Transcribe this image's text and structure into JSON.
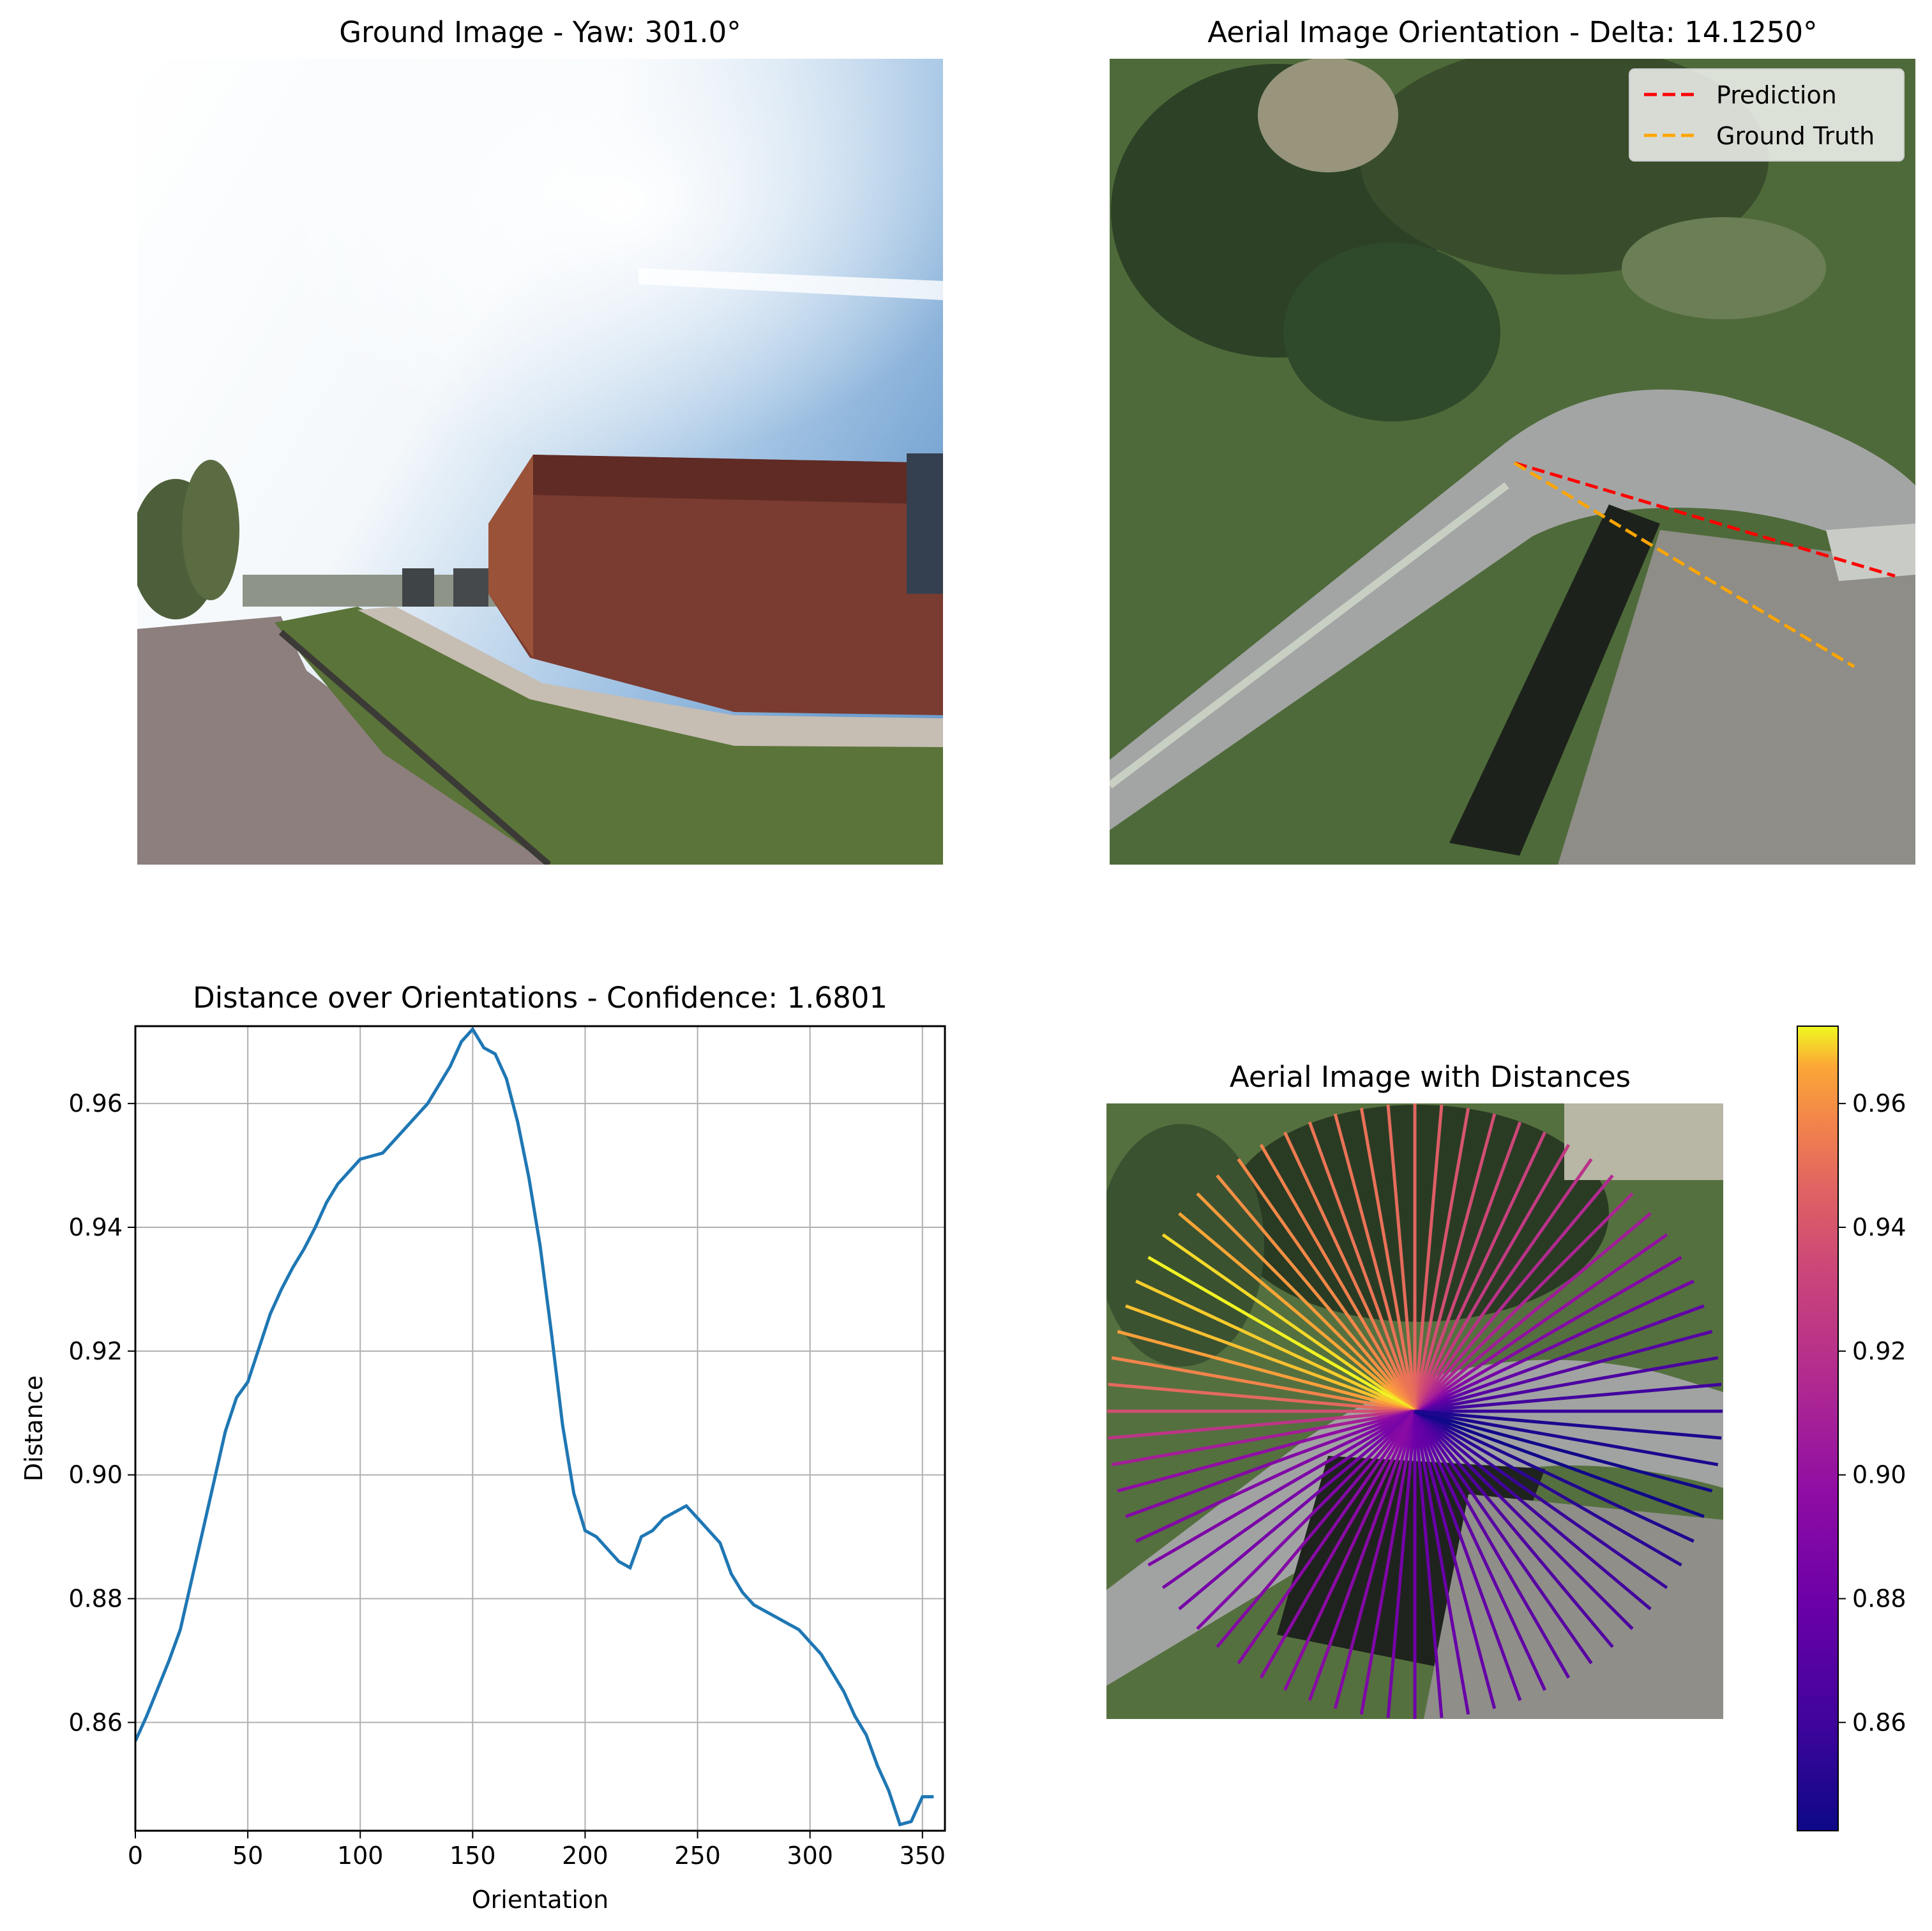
{
  "figure": {
    "ground": {
      "title": "Ground Image - Yaw: 301.0°"
    },
    "aerial": {
      "title": "Aerial Image Orientation - Delta: 14.1250°",
      "legend": [
        {
          "label": "Prediction",
          "color": "#ff0000",
          "style": "dashed"
        },
        {
          "label": "Ground Truth",
          "color": "#ffa500",
          "style": "dashed"
        }
      ]
    },
    "distances": {
      "title": "Aerial Image with Distances",
      "colormap": "plasma"
    }
  },
  "chart_data": [
    {
      "type": "line",
      "title": "Distance over Orientations - Confidence: 1.6801",
      "xlabel": "Orientation",
      "ylabel": "Distance",
      "xlim": [
        0,
        360
      ],
      "ylim": [
        0.8425,
        0.9725
      ],
      "xticks": [
        "0",
        "50",
        "100",
        "150",
        "200",
        "250",
        "300",
        "350"
      ],
      "yticks": [
        "0.86",
        "0.88",
        "0.90",
        "0.92",
        "0.94",
        "0.96"
      ],
      "grid": true,
      "color": "#1f77b4",
      "x": [
        0,
        5,
        10,
        15,
        20,
        25,
        30,
        35,
        40,
        45,
        50,
        55,
        60,
        65,
        70,
        75,
        80,
        85,
        90,
        95,
        100,
        105,
        110,
        115,
        120,
        125,
        130,
        135,
        140,
        145,
        150,
        155,
        160,
        165,
        170,
        175,
        180,
        185,
        190,
        195,
        200,
        205,
        210,
        215,
        220,
        225,
        230,
        235,
        240,
        245,
        250,
        255,
        260,
        265,
        270,
        275,
        280,
        285,
        290,
        295,
        300,
        305,
        310,
        315,
        320,
        325,
        330,
        335,
        340,
        345,
        350,
        355
      ],
      "y": [
        0.857,
        0.861,
        0.8655,
        0.87,
        0.875,
        0.883,
        0.891,
        0.899,
        0.907,
        0.9125,
        0.915,
        0.9205,
        0.926,
        0.93,
        0.9335,
        0.9365,
        0.94,
        0.944,
        0.947,
        0.949,
        0.951,
        0.9515,
        0.952,
        0.954,
        0.956,
        0.958,
        0.96,
        0.963,
        0.966,
        0.97,
        0.972,
        0.969,
        0.968,
        0.964,
        0.957,
        0.948,
        0.937,
        0.923,
        0.908,
        0.897,
        0.891,
        0.89,
        0.888,
        0.886,
        0.885,
        0.89,
        0.891,
        0.893,
        0.894,
        0.895,
        0.893,
        0.891,
        0.889,
        0.884,
        0.881,
        0.879,
        0.878,
        0.877,
        0.876,
        0.875,
        0.873,
        0.871,
        0.868,
        0.865,
        0.861,
        0.858,
        0.853,
        0.849,
        0.8435,
        0.844,
        0.848,
        0.848
      ]
    },
    {
      "type": "radial",
      "title": "Aerial Image with Distances",
      "colorbar_ticks": [
        "0.86",
        "0.88",
        "0.90",
        "0.92",
        "0.94",
        "0.96"
      ],
      "colorbar_range": [
        0.8425,
        0.9725
      ],
      "orientations": [
        0,
        5,
        10,
        15,
        20,
        25,
        30,
        35,
        40,
        45,
        50,
        55,
        60,
        65,
        70,
        75,
        80,
        85,
        90,
        95,
        100,
        105,
        110,
        115,
        120,
        125,
        130,
        135,
        140,
        145,
        150,
        155,
        160,
        165,
        170,
        175,
        180,
        185,
        190,
        195,
        200,
        205,
        210,
        215,
        220,
        225,
        230,
        235,
        240,
        245,
        250,
        255,
        260,
        265,
        270,
        275,
        280,
        285,
        290,
        295,
        300,
        305,
        310,
        315,
        320,
        325,
        330,
        335,
        340,
        345,
        350,
        355
      ]
    }
  ]
}
